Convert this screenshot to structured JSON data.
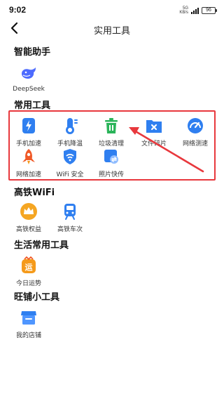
{
  "status_bar": {
    "time": "9:02",
    "net_speed_value": "5G",
    "net_speed_unit": "KB/s",
    "battery": "96"
  },
  "nav": {
    "title": "实用工具"
  },
  "sections": {
    "assistant": {
      "title": "智能助手",
      "items": [
        {
          "label": "DeepSeek"
        }
      ]
    },
    "common": {
      "title": "常用工具",
      "items": [
        {
          "label": "手机加速"
        },
        {
          "label": "手机降温"
        },
        {
          "label": "垃圾清理"
        },
        {
          "label": "文件碎片"
        },
        {
          "label": "网络测速"
        },
        {
          "label": "网络加速"
        },
        {
          "label": "WiFi 安全"
        },
        {
          "label": "照片快传"
        }
      ]
    },
    "rail": {
      "title": "高铁WiFi",
      "items": [
        {
          "label": "高铁权益"
        },
        {
          "label": "高铁车次"
        }
      ]
    },
    "life": {
      "title": "生活常用工具",
      "items": [
        {
          "label": "今日运势"
        }
      ]
    },
    "shop": {
      "title": "旺铺小工具",
      "items": [
        {
          "label": "我的店铺"
        }
      ]
    }
  },
  "colors": {
    "accent_blue": "#2f7ff0",
    "highlight_red": "#e8383d",
    "green": "#2bb45a",
    "orange": "#f59a1a",
    "red_orange": "#f05a28"
  },
  "icons": {
    "deepseek": "whale-icon",
    "phone_boost": "lightning-icon",
    "phone_cool": "thermometer-icon",
    "junk_clean": "trash-icon",
    "file_shred": "file-delete-icon",
    "speed_test": "speedometer-icon",
    "net_boost": "rocket-icon",
    "wifi_security": "wifi-shield-icon",
    "photo_transfer": "photo-transfer-icon",
    "rail_benefit": "crown-icon",
    "rail_train": "train-icon",
    "fortune": "fortune-icon",
    "my_shop": "shop-icon"
  }
}
